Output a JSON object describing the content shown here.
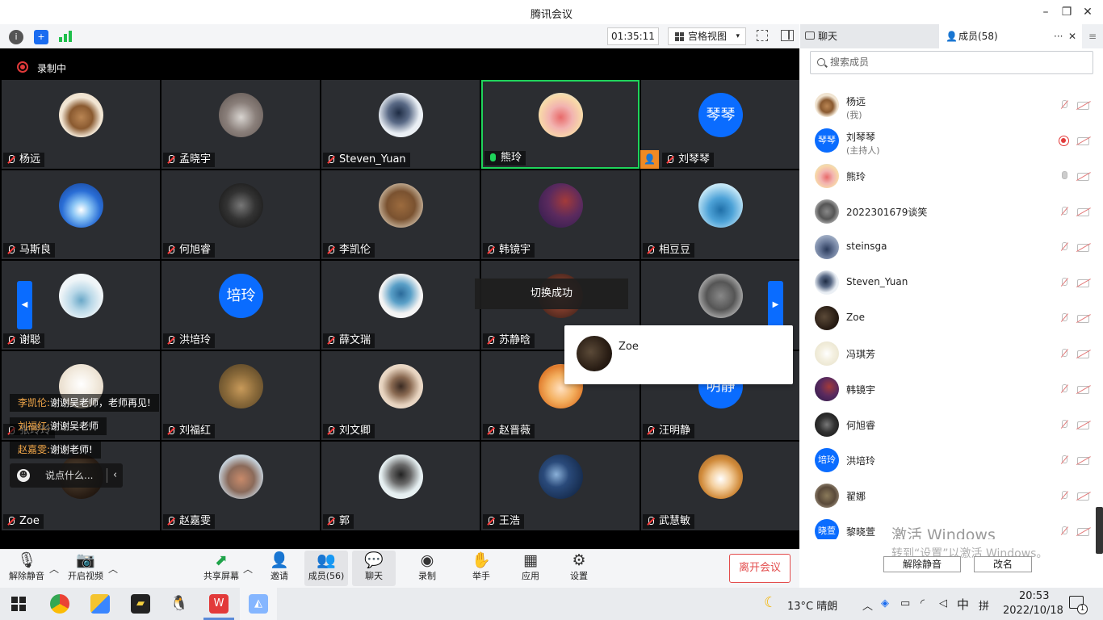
{
  "window": {
    "title": "腾讯会议",
    "min": "–",
    "restore": "❐",
    "close": "✕"
  },
  "toolbar": {
    "timer": "01:35:11",
    "view": "宫格视图",
    "caret": "▾"
  },
  "recording": {
    "label": "录制中"
  },
  "tiles": [
    {
      "name": "杨远",
      "avatar": "radial-gradient(circle at 50% 55%,#b98553 0,#8a5a30 35%,#f2e6d4 60%,#e9d9c2 100%)",
      "text": ""
    },
    {
      "name": "孟晓宇",
      "avatar": "radial-gradient(circle at 50% 55%,#d8d4d0 0,#8a7f7a 45%,#5a504c 100%)",
      "text": ""
    },
    {
      "name": "Steven_Yuan",
      "avatar": "radial-gradient(circle at 45% 45%,#1e2c44 0,#5a6a86 30%,#e9eef4 60%,#f4f6f8 100%)",
      "text": ""
    },
    {
      "name": "熊玲",
      "avatar": "radial-gradient(circle at 50% 55%,#e86a6a 0,#f2b3b0 35%,#f8d9a8 65%,#b6e0ee 100%)",
      "text": ""
    },
    {
      "name": "刘琴琴",
      "avatar": "#0a6cff",
      "text": "琴琴"
    },
    {
      "name": "马斯良",
      "avatar": "radial-gradient(circle at 50% 60%,#ffffff 0,#8cc6f5 25%,#2a6ed6 55%,#143b8a 100%)",
      "text": ""
    },
    {
      "name": "何旭睿",
      "avatar": "radial-gradient(circle at 50% 50%,#777 0,#333 45%,#111 100%)",
      "text": ""
    },
    {
      "name": "李凯伦",
      "avatar": "radial-gradient(circle at 50% 50%,#9c6b3e 0,#7a5230 45%,#c6b29a 75%,#e2d6c6 100%)",
      "text": ""
    },
    {
      "name": "韩镜宇",
      "avatar": "radial-gradient(circle at 60% 40%,#a33a3a 0,#5a2a5e 45%,#2a1a4a 100%)",
      "text": ""
    },
    {
      "name": "相豆豆",
      "avatar": "radial-gradient(circle at 50% 60%,#1f6fa8 0,#4ea3d8 35%,#bfe4f5 70%,#e9f6fb 100%)",
      "text": ""
    },
    {
      "name": "谢聪",
      "avatar": "radial-gradient(circle at 50% 60%,#6aa8c8 0,#b9d8e8 30%,#eef4f7 60%,#f7fafb 100%)",
      "text": ""
    },
    {
      "name": "洪培玲",
      "avatar": "#0a6cff",
      "text": "培玲"
    },
    {
      "name": "薛文瑞",
      "avatar": "radial-gradient(circle at 50% 45%,#2a6a9a 0,#5aa0c8 30%,#f2f2f2 60%,#ffffff 100%)",
      "text": ""
    },
    {
      "name": "苏静晗",
      "avatar": "radial-gradient(circle at 50% 50%,#c25a3a 0,#7a3a2a 45%,#2a1a15 100%)",
      "text": ""
    },
    {
      "name": "",
      "avatar": "radial-gradient(circle at 50% 50%,#888 0,#555 45%,#bbb 80%,#ddd 100%)",
      "text": ""
    },
    {
      "name": "张玲玲",
      "avatar": "radial-gradient(circle at 50% 45%,#fff 0,#f4ede2 40%,#e8dccb 70%,#d6c7b2 100%)",
      "text": ""
    },
    {
      "name": "刘福红",
      "avatar": "radial-gradient(circle at 50% 55%,#c89a5a 0,#8a6a3a 45%,#4a3a22 100%)",
      "text": ""
    },
    {
      "name": "刘文卿",
      "avatar": "radial-gradient(circle at 50% 50%,#3a2a22 0,#8a6a52 30%,#e6d2be 60%,#f5ece2 100%)",
      "text": ""
    },
    {
      "name": "赵晋薇",
      "avatar": "radial-gradient(circle at 50% 55%,#ffe0c0 0,#f4b060 40%,#e07a2a 70%,#fff 100%)",
      "text": ""
    },
    {
      "name": "汪明静",
      "avatar": "#0a6cff",
      "text": "明静"
    },
    {
      "name": "Zoe",
      "avatar": "radial-gradient(circle at 40% 45%,#5b4a38 0,#2a1e15 60%,#100a06 100%)",
      "text": ""
    },
    {
      "name": "赵嘉雯",
      "avatar": "radial-gradient(circle at 50% 55%,#c88a6a 0,#8a6a5a 40%,#c6d2dc 70%,#e4eaf0 100%)",
      "text": ""
    },
    {
      "name": "郭",
      "avatar": "radial-gradient(circle at 50% 45%,#222 0,#6a6a6a 30%,#e4eef0 60%,#f4f8f9 100%)",
      "text": ""
    },
    {
      "name": "王浩",
      "avatar": "radial-gradient(circle at 40% 45%,#8ab0d8 0,#2a4a7a 35%,#0a1a34 100%)",
      "text": ""
    },
    {
      "name": "武慧敏",
      "avatar": "radial-gradient(circle at 50% 55%,#fff 0,#f4d0a0 30%,#d08a3a 60%,#8a5a2a 100%)",
      "text": ""
    }
  ],
  "toast": "切换成功",
  "popup": {
    "name": "Zoe"
  },
  "chat_messages": [
    {
      "who": "李凯伦:",
      "text": "谢谢吴老师，老师再见!"
    },
    {
      "who": "刘福红:",
      "text": "谢谢吴老师"
    },
    {
      "who": "赵嘉雯:",
      "text": "谢谢老师!"
    }
  ],
  "chat_input": {
    "placeholder": "说点什么...",
    "chevron": "‹"
  },
  "bottom": {
    "unmute": "解除静音",
    "video": "开启视频",
    "share": "共享屏幕",
    "invite": "邀请",
    "members": "成员(56)",
    "chat": "聊天",
    "record": "录制",
    "raise": "举手",
    "apps": "应用",
    "settings": "设置",
    "leave": "离开会议"
  },
  "panel": {
    "tab_chat": "聊天",
    "tab_members": "成员(58)",
    "more": "···",
    "close": "✕",
    "menu": "≡",
    "search_placeholder": "搜索成员",
    "unmute_all": "解除静音",
    "rename": "改名"
  },
  "members": [
    {
      "name": "杨远",
      "sub": "(我)",
      "avatar": "radial-gradient(circle at 50% 55%,#b98553 0,#8a5a30 35%,#f2e6d4 60%,#e9d9c2 100%)",
      "text": "",
      "mic": "muted",
      "cam": false
    },
    {
      "name": "刘琴琴",
      "sub": "(主持人)",
      "avatar": "#0a6cff",
      "text": "琴琴",
      "mic": "rec",
      "cam": false
    },
    {
      "name": "熊玲",
      "sub": "",
      "avatar": "radial-gradient(circle at 50% 55%,#e86a6a 0,#f2b3b0 35%,#f8d9a8 65%,#b6e0ee 100%)",
      "text": "",
      "mic": "on",
      "cam": true
    },
    {
      "name": "2022301679谈笑",
      "sub": "",
      "avatar": "radial-gradient(circle at 50% 50%,#888 0,#555 45%,#bbb 80%,#ddd 100%)",
      "text": "",
      "mic": "muted",
      "cam": true
    },
    {
      "name": "steinsga",
      "sub": "",
      "avatar": "radial-gradient(circle at 50% 60%,#2a3a5a 0,#6a7a9a 40%,#c8d4e4 100%)",
      "text": "",
      "mic": "muted",
      "cam": true
    },
    {
      "name": "Steven_Yuan",
      "sub": "",
      "avatar": "radial-gradient(circle at 45% 45%,#1e2c44 0,#5a6a86 30%,#e9eef4 60%,#f4f6f8 100%)",
      "text": "",
      "mic": "muted",
      "cam": true
    },
    {
      "name": "Zoe",
      "sub": "",
      "avatar": "radial-gradient(circle at 40% 45%,#5b4a38 0,#2a1e15 60%,#100a06 100%)",
      "text": "",
      "mic": "muted",
      "cam": true
    },
    {
      "name": "冯琪芳",
      "sub": "",
      "avatar": "radial-gradient(circle at 50% 50%,#fff 0,#f4f0e0 40%,#e6e0c8 100%)",
      "text": "",
      "mic": "muted",
      "cam": true
    },
    {
      "name": "韩镜宇",
      "sub": "",
      "avatar": "radial-gradient(circle at 60% 40%,#a33a3a 0,#5a2a5e 45%,#2a1a4a 100%)",
      "text": "",
      "mic": "muted",
      "cam": true
    },
    {
      "name": "何旭睿",
      "sub": "",
      "avatar": "radial-gradient(circle at 50% 50%,#777 0,#333 45%,#111 100%)",
      "text": "",
      "mic": "muted",
      "cam": true
    },
    {
      "name": "洪培玲",
      "sub": "",
      "avatar": "#0a6cff",
      "text": "培玲",
      "mic": "muted",
      "cam": true
    },
    {
      "name": "翟娜",
      "sub": "",
      "avatar": "radial-gradient(circle at 50% 50%,#8a7a5a 0,#5a4a3a 50%,#c8bca8 100%)",
      "text": "",
      "mic": "muted",
      "cam": true
    },
    {
      "name": "黎晓萱",
      "sub": "",
      "avatar": "#0a6cff",
      "text": "晓萱",
      "mic": "muted",
      "cam": true
    }
  ],
  "watermark": {
    "line1": "激活 Windows",
    "line2": "转到“设置”以激活 Windows。"
  },
  "taskbar": {
    "weather": "13°C  晴朗",
    "ime": "中",
    "ime2": "拼",
    "time": "20:53",
    "date": "2022/10/18",
    "notif": "1"
  }
}
